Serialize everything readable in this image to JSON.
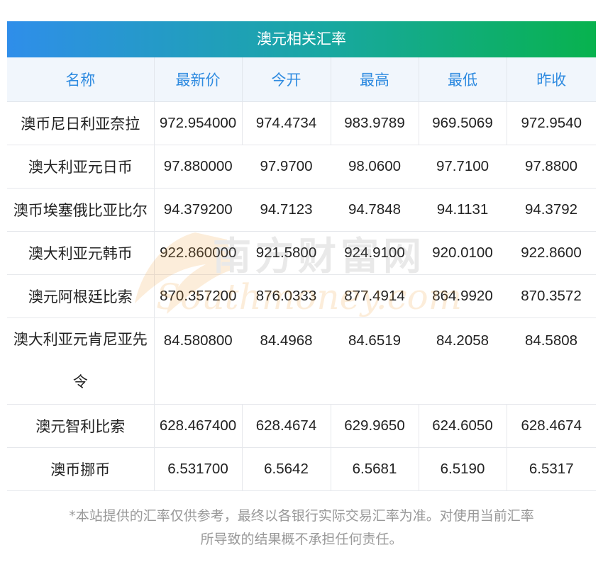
{
  "title": "澳元相关汇率",
  "headers": [
    "名称",
    "最新价",
    "今开",
    "最高",
    "最低",
    "昨收"
  ],
  "rows": [
    {
      "name": "澳币尼日利亚奈拉",
      "latest": "972.954000",
      "open": "974.4734",
      "high": "983.9789",
      "low": "969.5069",
      "prev": "972.9540"
    },
    {
      "name": "澳大利亚元日币",
      "latest": "97.880000",
      "open": "97.9700",
      "high": "98.0600",
      "low": "97.7100",
      "prev": "97.8800"
    },
    {
      "name": "澳币埃塞俄比亚比尔",
      "latest": "94.379200",
      "open": "94.7123",
      "high": "94.7848",
      "low": "94.1131",
      "prev": "94.3792"
    },
    {
      "name": "澳大利亚元韩币",
      "latest": "922.860000",
      "open": "921.5800",
      "high": "924.9100",
      "low": "920.0100",
      "prev": "922.8600"
    },
    {
      "name": "澳元阿根廷比索",
      "latest": "870.357200",
      "open": "876.0333",
      "high": "877.4914",
      "low": "864.9920",
      "prev": "870.3572"
    },
    {
      "name": "澳大利亚元肯尼亚先令",
      "latest": "84.580800",
      "open": "84.4968",
      "high": "84.6519",
      "low": "84.2058",
      "prev": "84.5808"
    },
    {
      "name": "澳元智利比索",
      "latest": "628.467400",
      "open": "628.4674",
      "high": "629.9650",
      "low": "624.6050",
      "prev": "628.4674"
    },
    {
      "name": "澳币挪币",
      "latest": "6.531700",
      "open": "6.5642",
      "high": "6.5681",
      "low": "6.5190",
      "prev": "6.5317"
    }
  ],
  "watermark": {
    "cn": "南方财富网",
    "en": "Southmoney.com"
  },
  "footnote_line1": "*本站提供的汇率仅供参考，最终以各银行实际交易汇率为准。对使用当前汇率",
  "footnote_line2": "所导致的结果概不承担任何责任。"
}
